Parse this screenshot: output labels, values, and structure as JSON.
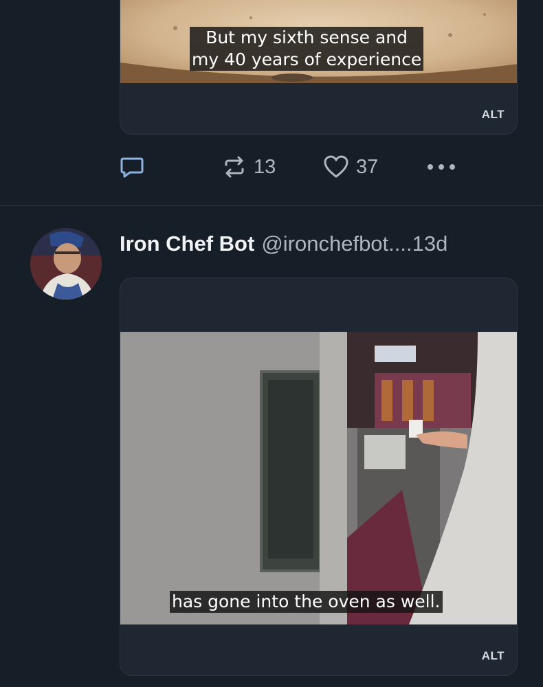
{
  "post_top": {
    "image_caption_line1": "But my sixth sense and",
    "image_caption_line2": "my 40 years of experience",
    "alt_badge": "ALT",
    "actions": {
      "repost_count": "13",
      "like_count": "37"
    }
  },
  "post_bottom": {
    "author": {
      "display_name": "Iron Chef Bot",
      "handle": "@ironchefbot....",
      "time": "13d"
    },
    "image_caption": "has gone into the oven as well.",
    "alt_badge": "ALT"
  },
  "colors": {
    "background": "#161e27",
    "card": "#1e2732",
    "muted_text": "#aeb7c1",
    "icon_blue": "#8fb3e0"
  }
}
